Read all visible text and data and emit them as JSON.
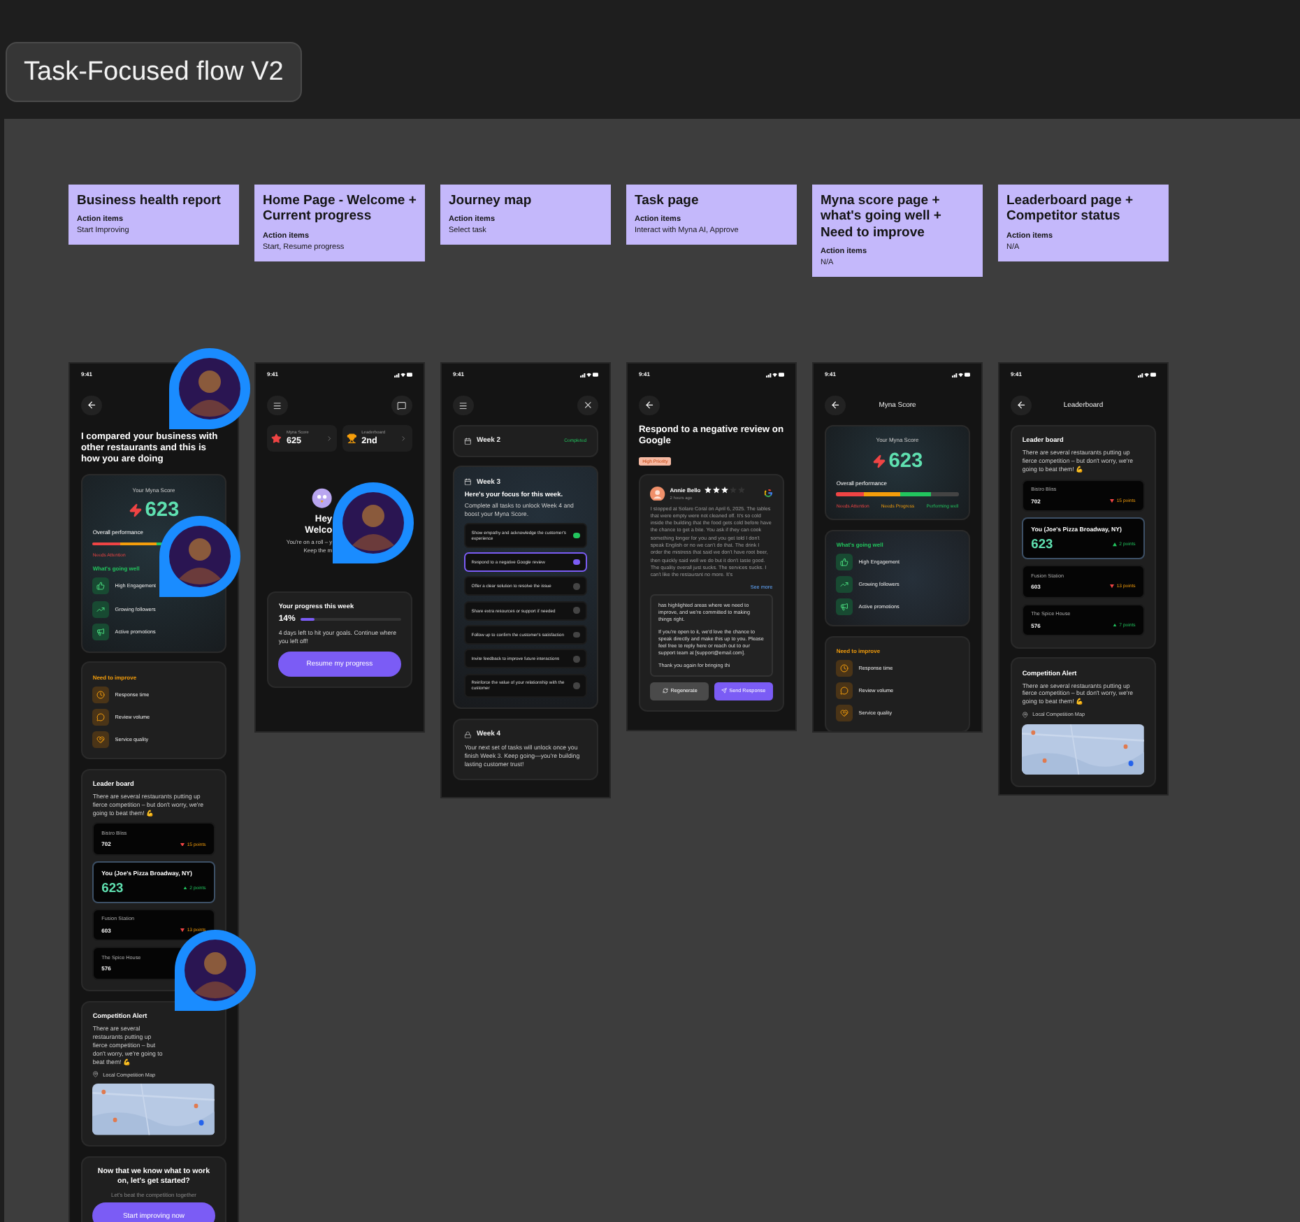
{
  "canvas_title": "Task-Focused flow V2",
  "notes": [
    {
      "title": "Business health report",
      "action_label": "Action items",
      "action": "Start Improving"
    },
    {
      "title": "Home Page - Welcome + Current progress",
      "action_label": "Action items",
      "action": "Start, Resume progress"
    },
    {
      "title": "Journey map",
      "action_label": "Action items",
      "action": "Select task"
    },
    {
      "title": "Task page",
      "action_label": "Action items",
      "action": "Interact with Myna AI, Approve"
    },
    {
      "title": "Myna score page + what's going well + Need to improve",
      "action_label": "Action items",
      "action": "N/A"
    },
    {
      "title": "Leaderboard page + Competitor status",
      "action_label": "Action items",
      "action": "N/A"
    }
  ],
  "screens": [
    {
      "kind": "report",
      "time": "9:41",
      "heading": "I compared your business with other restaurants and this is how you are doing",
      "score": {
        "label": "Your Myna Score",
        "value": "623",
        "performance_label": "Overall performance",
        "scale": [
          "Needs Attention"
        ]
      },
      "going_well": {
        "title": "What's going well",
        "items": [
          "High Engagement",
          "Growing followers",
          "Active promotions"
        ]
      },
      "improve": {
        "title": "Need to improve",
        "items": [
          "Response time",
          "Review volume",
          "Service quality"
        ]
      },
      "leaderboard": {
        "title": "Leader board",
        "text": "There are several restaurants putting up fierce competition – but don't worry, we're going to beat them! 💪",
        "rows": [
          {
            "name": "Bistro Bliss",
            "score": "702",
            "change": "15 points",
            "rising": false,
            "you": false
          },
          {
            "name": "You (Joe's Pizza Broadway, NY)",
            "score": "623",
            "change": "2 points",
            "rising": true,
            "you": true
          },
          {
            "name": "Fusion Station",
            "score": "603",
            "change": "13 points",
            "rising": false,
            "you": false
          },
          {
            "name": "The Spice House",
            "score": "576",
            "you": false
          }
        ]
      },
      "competition": {
        "title": "Competition Alert",
        "text": "There are several restaurants putting up fierce competition – but don't worry, we're going to beat them! 💪",
        "map_label": "Local Competition Map"
      },
      "cta": {
        "title": "Now that we know what to work on, let's get started?",
        "text": "Let's beat the competition together",
        "button": "Start improving now"
      }
    },
    {
      "kind": "home",
      "time": "9:41",
      "stats": [
        {
          "kind": "score",
          "label": "Myna Score",
          "value": "625"
        },
        {
          "kind": "rank",
          "label": "Leaderboard",
          "value": "2nd"
        }
      ],
      "greeting": [
        "Hey",
        "Welco",
        "You're on a roll – y",
        "Keep the m"
      ],
      "progress": {
        "title": "Your progress this week",
        "percent": "14%",
        "level": 0.14,
        "note": "4 days left to hit your goals. Continue where you left off!",
        "button": "Resume my progress"
      }
    },
    {
      "kind": "journey",
      "time": "9:41",
      "done_week": {
        "label": "Week 2",
        "status": "Completed"
      },
      "current": {
        "label": "Week 3",
        "title": "Here's your focus for this week.",
        "text": "Complete all tasks to unlock Week 4 and boost your Myna Score.",
        "tasks": [
          {
            "text": "Show empathy and acknowledge the customer's experience",
            "done": true,
            "selected": false
          },
          {
            "text": "Respond to a negative Google review",
            "done": false,
            "selected": true
          },
          {
            "text": "Offer a clear solution to resolve the issue",
            "done": false,
            "selected": false
          },
          {
            "text": "Share extra resources or support if needed",
            "done": false,
            "selected": false
          },
          {
            "text": "Follow up to confirm the customer's satisfaction",
            "done": false,
            "selected": false
          },
          {
            "text": "Invite feedback to improve future interactions",
            "done": false,
            "selected": false
          },
          {
            "text": "Reinforce the value of your relationship with the customer",
            "done": false,
            "selected": false
          }
        ]
      },
      "locked_week": {
        "label": "Week 4",
        "text": "Your next set of tasks will unlock once you finish Week 3. Keep going—you're building lasting customer trust!"
      }
    },
    {
      "kind": "task",
      "time": "9:41",
      "title": "Respond to a negative review on Google",
      "tag": "High Priority",
      "review": {
        "author": "Annie Bello",
        "stars": 3,
        "time": "2 hours ago",
        "text": "I stopped at Solare Coral on April 6, 2025. The tables that were empty were not cleaned off. It's so cold inside the building that the food gets cold before have the chance to get a bite. You ask if they can cook something longer for you and you get told I don't speak English or no we can't do that. The drink I order the mistress that said we don't have root beer, then quickly said well we do but it don't taste good. The quality overall just sucks. The services sucks. I can't like the restaurant no more. It's",
        "more": "See more"
      },
      "reply": [
        "has highlighted areas where we need to improve, and we're committed to making things right.",
        "If you're open to it, we'd love the chance to speak directly and make this up to you. Please feel free to reply here or reach out to our support team at [support@email.com].",
        "Thank you again for bringing thi"
      ],
      "buttons": [
        {
          "kind": "secondary",
          "label": "Regenerate"
        },
        {
          "kind": "primary",
          "label": "Send Response"
        }
      ]
    },
    {
      "kind": "score",
      "time": "9:41",
      "title": "Myna Score",
      "score": {
        "label": "Your Myna Score",
        "value": "623",
        "performance_label": "Overall performance",
        "scale": [
          "Needs Attention",
          "Needs Progress",
          "Performing well"
        ]
      },
      "going_well": {
        "title": "What's going well",
        "items": [
          "High Engagement",
          "Growing followers",
          "Active promotions"
        ]
      },
      "improve": {
        "title": "Need to improve",
        "items": [
          "Response time",
          "Review volume",
          "Service quality"
        ]
      }
    },
    {
      "kind": "leaderboard",
      "time": "9:41",
      "title": "Leaderboard",
      "leaderboard": {
        "title": "Leader board",
        "text": "There are several restaurants putting up fierce competition – but don't worry, we're going to beat them! 💪",
        "rows": [
          {
            "name": "Bistro Bliss",
            "score": "702",
            "change": "15 points",
            "rising": false,
            "you": false
          },
          {
            "name": "You (Joe's Pizza Broadway, NY)",
            "score": "623",
            "change": "2 points",
            "rising": true,
            "you": true
          },
          {
            "name": "Fusion Station",
            "score": "603",
            "change": "13 points",
            "rising": false,
            "you": false
          },
          {
            "name": "The Spice House",
            "score": "576",
            "change": "7 points",
            "rising": true,
            "you": false
          }
        ]
      },
      "competition": {
        "title": "Competition Alert",
        "text": "There are several restaurants putting up fierce competition – but don't worry, we're going to beat them! 💪",
        "map_label": "Local Competition Map"
      }
    }
  ]
}
